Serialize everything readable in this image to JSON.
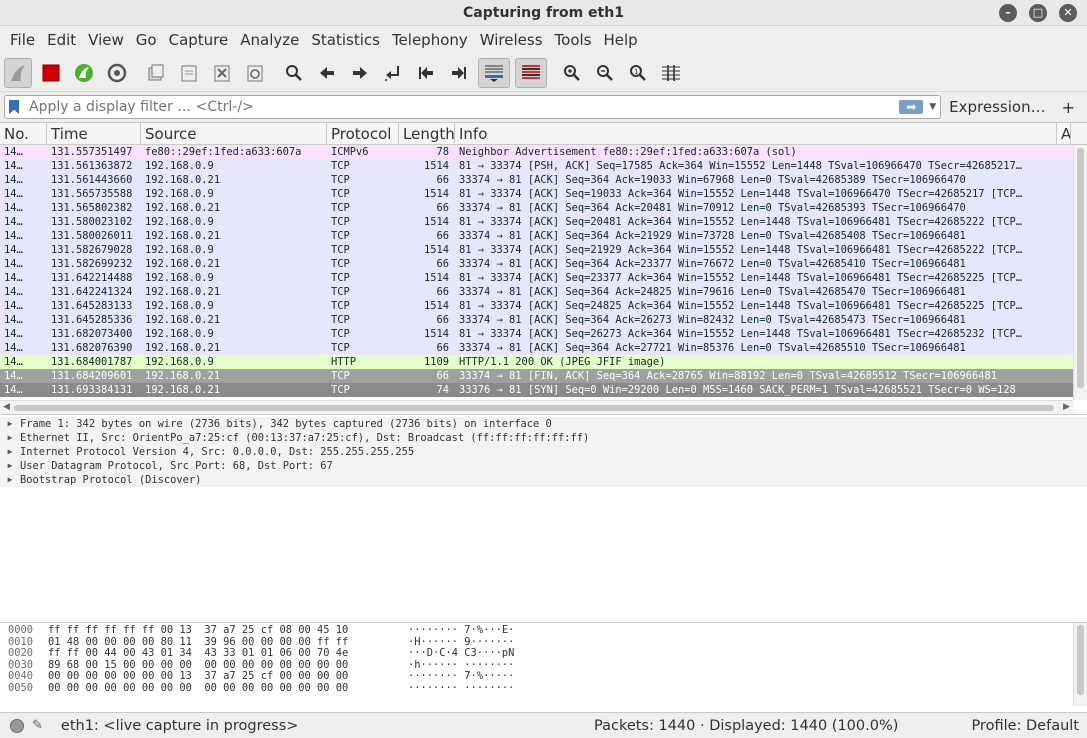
{
  "window": {
    "title": "Capturing from eth1"
  },
  "menu": [
    "File",
    "Edit",
    "View",
    "Go",
    "Capture",
    "Analyze",
    "Statistics",
    "Telephony",
    "Wireless",
    "Tools",
    "Help"
  ],
  "toolbar": {
    "icons": [
      "shark-fin-start-icon",
      "stop-capture-icon",
      "restart-capture-icon",
      "capture-options-icon",
      "open-file-icon",
      "save-file-icon",
      "close-file-icon",
      "reload-file-icon",
      "find-packet-icon",
      "go-back-icon",
      "go-forward-icon",
      "go-to-packet-icon",
      "go-first-icon",
      "go-last-icon",
      "auto-scroll-icon",
      "colorize-icon",
      "zoom-in-icon",
      "zoom-out-icon",
      "zoom-normal-icon",
      "resize-columns-icon"
    ]
  },
  "filter": {
    "placeholder": "Apply a display filter … <Ctrl-/>",
    "expression_label": "Expression…",
    "plus_label": "+"
  },
  "packet_list": {
    "columns": {
      "no": "No.",
      "time": "Time",
      "source": "Source",
      "protocol": "Protocol",
      "length": "Length",
      "info": "Info",
      "extra": "A"
    },
    "rows": [
      {
        "no": "14…",
        "time": "131.557351497",
        "src": "fe80::29ef:1fed:a633:607a",
        "proto": "ICMPv6",
        "len": "78",
        "info": "Neighbor Advertisement fe80::29ef:1fed:a633:607a (sol)",
        "style": "icmp"
      },
      {
        "no": "14…",
        "time": "131.561363872",
        "src": "192.168.0.9",
        "proto": "TCP",
        "len": "1514",
        "info": "81 → 33374 [PSH, ACK] Seq=17585 Ack=364 Win=15552 Len=1448 TSval=106966470 TSecr=42685217…",
        "style": "tcp"
      },
      {
        "no": "14…",
        "time": "131.561443660",
        "src": "192.168.0.21",
        "proto": "TCP",
        "len": "66",
        "info": "33374 → 81 [ACK] Seq=364 Ack=19033 Win=67968 Len=0 TSval=42685389 TSecr=106966470",
        "style": "tcp"
      },
      {
        "no": "14…",
        "time": "131.565735588",
        "src": "192.168.0.9",
        "proto": "TCP",
        "len": "1514",
        "info": "81 → 33374 [ACK] Seq=19033 Ack=364 Win=15552 Len=1448 TSval=106966470 TSecr=42685217 [TCP…",
        "style": "tcp"
      },
      {
        "no": "14…",
        "time": "131.565802382",
        "src": "192.168.0.21",
        "proto": "TCP",
        "len": "66",
        "info": "33374 → 81 [ACK] Seq=364 Ack=20481 Win=70912 Len=0 TSval=42685393 TSecr=106966470",
        "style": "tcp"
      },
      {
        "no": "14…",
        "time": "131.580023102",
        "src": "192.168.0.9",
        "proto": "TCP",
        "len": "1514",
        "info": "81 → 33374 [ACK] Seq=20481 Ack=364 Win=15552 Len=1448 TSval=106966481 TSecr=42685222 [TCP…",
        "style": "tcp"
      },
      {
        "no": "14…",
        "time": "131.580026011",
        "src": "192.168.0.21",
        "proto": "TCP",
        "len": "66",
        "info": "33374 → 81 [ACK] Seq=364 Ack=21929 Win=73728 Len=0 TSval=42685408 TSecr=106966481",
        "style": "tcp"
      },
      {
        "no": "14…",
        "time": "131.582679028",
        "src": "192.168.0.9",
        "proto": "TCP",
        "len": "1514",
        "info": "81 → 33374 [ACK] Seq=21929 Ack=364 Win=15552 Len=1448 TSval=106966481 TSecr=42685222 [TCP…",
        "style": "tcp"
      },
      {
        "no": "14…",
        "time": "131.582699232",
        "src": "192.168.0.21",
        "proto": "TCP",
        "len": "66",
        "info": "33374 → 81 [ACK] Seq=364 Ack=23377 Win=76672 Len=0 TSval=42685410 TSecr=106966481",
        "style": "tcp"
      },
      {
        "no": "14…",
        "time": "131.642214488",
        "src": "192.168.0.9",
        "proto": "TCP",
        "len": "1514",
        "info": "81 → 33374 [ACK] Seq=23377 Ack=364 Win=15552 Len=1448 TSval=106966481 TSecr=42685225 [TCP…",
        "style": "tcp"
      },
      {
        "no": "14…",
        "time": "131.642241324",
        "src": "192.168.0.21",
        "proto": "TCP",
        "len": "66",
        "info": "33374 → 81 [ACK] Seq=364 Ack=24825 Win=79616 Len=0 TSval=42685470 TSecr=106966481",
        "style": "tcp"
      },
      {
        "no": "14…",
        "time": "131.645283133",
        "src": "192.168.0.9",
        "proto": "TCP",
        "len": "1514",
        "info": "81 → 33374 [ACK] Seq=24825 Ack=364 Win=15552 Len=1448 TSval=106966481 TSecr=42685225 [TCP…",
        "style": "tcp"
      },
      {
        "no": "14…",
        "time": "131.645285336",
        "src": "192.168.0.21",
        "proto": "TCP",
        "len": "66",
        "info": "33374 → 81 [ACK] Seq=364 Ack=26273 Win=82432 Len=0 TSval=42685473 TSecr=106966481",
        "style": "tcp"
      },
      {
        "no": "14…",
        "time": "131.682073400",
        "src": "192.168.0.9",
        "proto": "TCP",
        "len": "1514",
        "info": "81 → 33374 [ACK] Seq=26273 Ack=364 Win=15552 Len=1448 TSval=106966481 TSecr=42685232 [TCP…",
        "style": "tcp"
      },
      {
        "no": "14…",
        "time": "131.682076390",
        "src": "192.168.0.21",
        "proto": "TCP",
        "len": "66",
        "info": "33374 → 81 [ACK] Seq=364 Ack=27721 Win=85376 Len=0 TSval=42685510 TSecr=106966481",
        "style": "tcp"
      },
      {
        "no": "14…",
        "time": "131.684001787",
        "src": "192.168.0.9",
        "proto": "HTTP",
        "len": "1109",
        "info": "HTTP/1.1 200 OK  (JPEG JFIF image)",
        "style": "http"
      },
      {
        "no": "14…",
        "time": "131.684209601",
        "src": "192.168.0.21",
        "proto": "TCP",
        "len": "66",
        "info": "33374 → 81 [FIN, ACK] Seq=364 Ack=28765 Win=88192 Len=0 TSval=42685512 TSecr=106966481",
        "style": "dark"
      },
      {
        "no": "14…",
        "time": "131.693384131",
        "src": "192.168.0.21",
        "proto": "TCP",
        "len": "74",
        "info": "33376 → 81 [SYN] Seq=0 Win=29200 Len=0 MSS=1460 SACK_PERM=1 TSval=42685521 TSecr=0 WS=128",
        "style": "dark2"
      }
    ]
  },
  "details": [
    "Frame 1: 342 bytes on wire (2736 bits), 342 bytes captured (2736 bits) on interface 0",
    "Ethernet II, Src: OrientPo_a7:25:cf (00:13:37:a7:25:cf), Dst: Broadcast (ff:ff:ff:ff:ff:ff)",
    "Internet Protocol Version 4, Src: 0.0.0.0, Dst: 255.255.255.255",
    "User Datagram Protocol, Src Port: 68, Dst Port: 67",
    "Bootstrap Protocol (Discover)"
  ],
  "bytes": [
    {
      "off": "0000",
      "hex": "ff ff ff ff ff ff 00 13  37 a7 25 cf 08 00 45 10",
      "ascii": "········ 7·%···E·"
    },
    {
      "off": "0010",
      "hex": "01 48 00 00 00 00 80 11  39 96 00 00 00 00 ff ff",
      "ascii": "·H······ 9·······"
    },
    {
      "off": "0020",
      "hex": "ff ff 00 44 00 43 01 34  43 33 01 01 06 00 70 4e",
      "ascii": "···D·C·4 C3····pN"
    },
    {
      "off": "0030",
      "hex": "89 68 00 15 00 00 00 00  00 00 00 00 00 00 00 00",
      "ascii": "·h······ ········"
    },
    {
      "off": "0040",
      "hex": "00 00 00 00 00 00 00 13  37 a7 25 cf 00 00 00 00",
      "ascii": "········ 7·%·····"
    },
    {
      "off": "0050",
      "hex": "00 00 00 00 00 00 00 00  00 00 00 00 00 00 00 00",
      "ascii": "········ ········"
    }
  ],
  "status": {
    "capture_text": "eth1: <live capture in progress>",
    "packets_text": "Packets: 1440 · Displayed: 1440 (100.0%)",
    "profile_text": "Profile: Default"
  }
}
